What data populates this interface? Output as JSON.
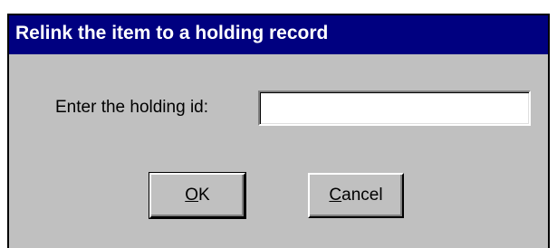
{
  "window": {
    "title": "Relink the item to a holding record"
  },
  "form": {
    "holding_id_label": "Enter the holding id:",
    "holding_id_value": "",
    "holding_id_placeholder": ""
  },
  "buttons": {
    "ok": {
      "mnemonic": "O",
      "rest": "K"
    },
    "cancel": {
      "mnemonic": "C",
      "rest": "ancel"
    }
  },
  "colors": {
    "titlebar": "#000080",
    "dialog_face": "#c0c0c0",
    "title_text": "#ffffff"
  }
}
